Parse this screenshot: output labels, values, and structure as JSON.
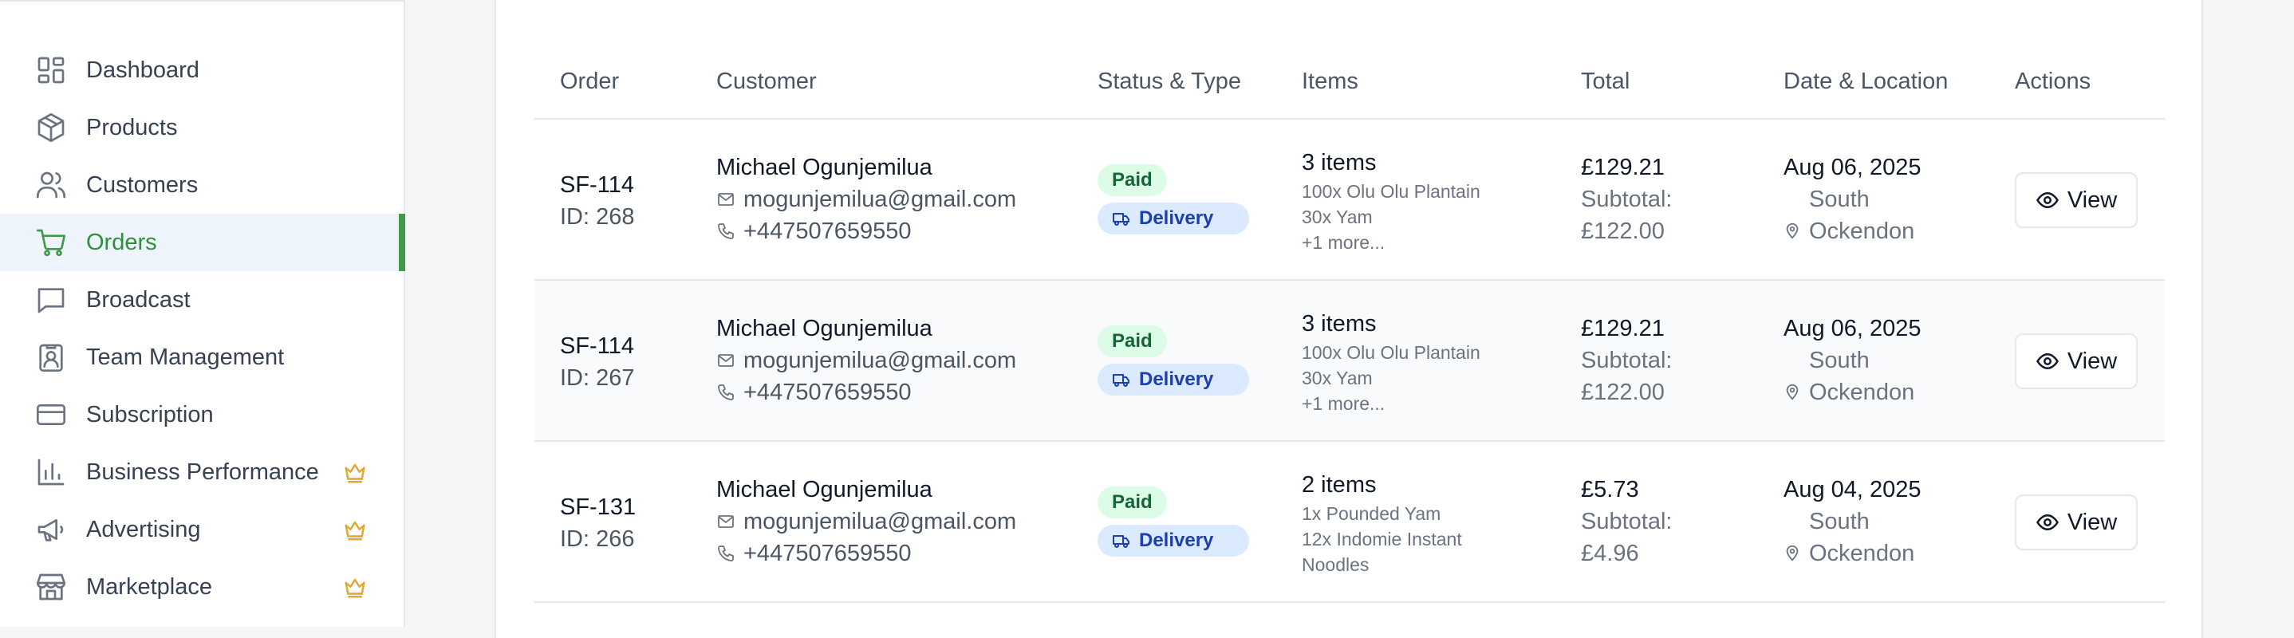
{
  "sidebar": {
    "items": [
      {
        "label": "Dashboard",
        "icon": "dashboard-icon",
        "premium": false,
        "active": false
      },
      {
        "label": "Products",
        "icon": "package-icon",
        "premium": false,
        "active": false
      },
      {
        "label": "Customers",
        "icon": "users-icon",
        "premium": false,
        "active": false
      },
      {
        "label": "Orders",
        "icon": "cart-icon",
        "premium": false,
        "active": true
      },
      {
        "label": "Broadcast",
        "icon": "message-icon",
        "premium": false,
        "active": false
      },
      {
        "label": "Team Management",
        "icon": "id-badge-icon",
        "premium": false,
        "active": false
      },
      {
        "label": "Subscription",
        "icon": "credit-card-icon",
        "premium": false,
        "active": false
      },
      {
        "label": "Business Performance",
        "icon": "bar-chart-icon",
        "premium": true,
        "active": false
      },
      {
        "label": "Advertising",
        "icon": "megaphone-icon",
        "premium": true,
        "active": false
      },
      {
        "label": "Marketplace",
        "icon": "store-icon",
        "premium": true,
        "active": false
      }
    ],
    "active_color": "#3f9b4a",
    "premium_color": "#e0a82e"
  },
  "table": {
    "headers": {
      "order": "Order",
      "customer": "Customer",
      "status": "Status & Type",
      "items": "Items",
      "total": "Total",
      "date": "Date & Location",
      "actions": "Actions"
    },
    "rows": [
      {
        "order": "SF-114",
        "id": "ID: 268",
        "name": "Michael Ogunjemilua",
        "email": "mogunjemilua@gmail.com",
        "phone": "+447507659550",
        "payment": "Paid",
        "type": "Delivery",
        "item_count": "3 items",
        "item1": "100x Olu Olu Plantain",
        "item2": "30x Yam",
        "item3": "+1 more...",
        "total": "£129.21",
        "subtotal_label": "Subtotal:",
        "subtotal": "£122.00",
        "date": "Aug 06, 2025",
        "loc1": "South",
        "loc2": "Ockendon",
        "action": "View"
      },
      {
        "order": "SF-114",
        "id": "ID: 267",
        "name": "Michael Ogunjemilua",
        "email": "mogunjemilua@gmail.com",
        "phone": "+447507659550",
        "payment": "Paid",
        "type": "Delivery",
        "item_count": "3 items",
        "item1": "100x Olu Olu Plantain",
        "item2": "30x Yam",
        "item3": "+1 more...",
        "total": "£129.21",
        "subtotal_label": "Subtotal:",
        "subtotal": "£122.00",
        "date": "Aug 06, 2025",
        "loc1": "South",
        "loc2": "Ockendon",
        "action": "View"
      },
      {
        "order": "SF-131",
        "id": "ID: 266",
        "name": "Michael Ogunjemilua",
        "email": "mogunjemilua@gmail.com",
        "phone": "+447507659550",
        "payment": "Paid",
        "type": "Delivery",
        "item_count": "2 items",
        "item1": "1x Pounded Yam",
        "item2": "12x Indomie Instant",
        "item3": "Noodles",
        "total": "£5.73",
        "subtotal_label": "Subtotal:",
        "subtotal": "£4.96",
        "date": "Aug 04, 2025",
        "loc1": "South",
        "loc2": "Ockendon",
        "action": "View"
      }
    ]
  }
}
